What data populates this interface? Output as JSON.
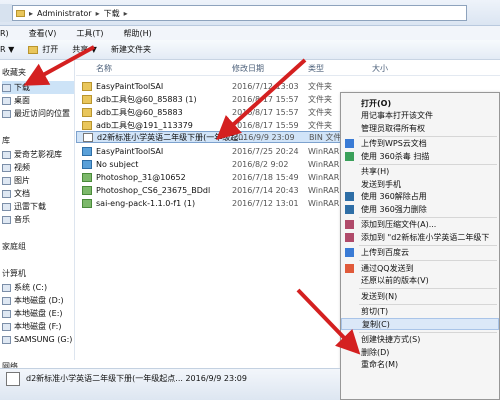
{
  "address": {
    "segments": [
      "Administrator",
      "下载"
    ]
  },
  "menu": {
    "items": [
      "R)",
      "查看(V)",
      "工具(T)",
      "帮助(H)"
    ]
  },
  "toolbar": {
    "items": [
      "R ▼",
      "打开",
      "共享 ▼",
      "新建文件夹"
    ]
  },
  "nav": {
    "items": [
      {
        "label": "收藏夹",
        "head": true
      },
      {
        "label": "下载",
        "sel": true
      },
      {
        "label": "桌面"
      },
      {
        "label": "最近访问的位置"
      },
      {
        "label": "库",
        "head": true
      },
      {
        "label": "爱奇艺影视库"
      },
      {
        "label": "视频"
      },
      {
        "label": "图片"
      },
      {
        "label": "文档"
      },
      {
        "label": "迅雷下载"
      },
      {
        "label": "音乐"
      },
      {
        "label": "家庭组",
        "head": true
      },
      {
        "label": "计算机",
        "head": true
      },
      {
        "label": "系统 (C:)"
      },
      {
        "label": "本地磁盘 (D:)"
      },
      {
        "label": "本地磁盘 (E:)"
      },
      {
        "label": "本地磁盘 (F:)"
      },
      {
        "label": "SAMSUNG (G:)"
      },
      {
        "label": "网络",
        "head": true
      }
    ]
  },
  "columns": {
    "name": "名称",
    "date": "修改日期",
    "type": "类型",
    "size": "大小"
  },
  "files": [
    {
      "name": "EasyPaintToolSAI",
      "date": "2016/7/12 13:03",
      "type": "文件夹",
      "icon": "folder"
    },
    {
      "name": "adb工具包@60_85883 (1)",
      "date": "2016/8/17 15:57",
      "type": "文件夹",
      "icon": "folder"
    },
    {
      "name": "adb工具包@60_85883",
      "date": "2016/8/17 15:57",
      "type": "文件夹",
      "icon": "folder"
    },
    {
      "name": "adb工具包@191_113379",
      "date": "2016/8/17 15:59",
      "type": "文件夹",
      "icon": "folder"
    },
    {
      "name": "d2新标准小学英语二年级下册(一年级起...",
      "date": "2016/9/9 23:09",
      "type": "BIN 文件",
      "icon": "bin",
      "sel": true
    },
    {
      "name": "EasyPaintToolSAI",
      "date": "2016/7/25 20:24",
      "type": "WinRAR Z",
      "icon": "img"
    },
    {
      "name": "No subject",
      "date": "2016/8/2 9:02",
      "type": "WinRAR 压",
      "icon": "img"
    },
    {
      "name": "Photoshop_31@10652",
      "date": "2016/7/18 15:49",
      "type": "WinRAR Z",
      "icon": "gr"
    },
    {
      "name": "Photoshop_CS6_23675_BDdl",
      "date": "2016/7/14 20:43",
      "type": "WinRAR Z",
      "icon": "gr"
    },
    {
      "name": "sai-eng-pack-1.1.0-f1 (1)",
      "date": "2016/7/12 13:01",
      "type": "WinRAR Z",
      "icon": "gr"
    }
  ],
  "context_menu": {
    "items": [
      {
        "label": "打开(O)",
        "bold": true
      },
      {
        "label": "用记事本打开该文件"
      },
      {
        "label": "管理员取得所有权"
      },
      {
        "sep": true
      },
      {
        "label": "上传到WPS云文档",
        "icon": "#3a7bd5"
      },
      {
        "label": "使用 360杀毒 扫描",
        "icon": "#3aa05a"
      },
      {
        "sep": true
      },
      {
        "label": "共享(H)"
      },
      {
        "label": "发送到手机"
      },
      {
        "label": "使用 360解除占用",
        "icon": "#2e6ea6"
      },
      {
        "label": "使用 360强力删除",
        "icon": "#2e6ea6"
      },
      {
        "sep": true
      },
      {
        "label": "添加到压缩文件(A)...",
        "icon": "#b04a6a"
      },
      {
        "label": "添加到 \"d2新标准小学英语二年级下",
        "icon": "#b04a6a"
      },
      {
        "sep": true
      },
      {
        "label": "上传到百度云",
        "icon": "#3a7bd5"
      },
      {
        "sep": true
      },
      {
        "label": "通过QQ发送到",
        "icon": "#e05a3a"
      },
      {
        "label": "还原以前的版本(V)"
      },
      {
        "sep": true
      },
      {
        "label": "发送到(N)"
      },
      {
        "sep": true
      },
      {
        "label": "剪切(T)"
      },
      {
        "label": "复制(C)",
        "hl": true
      },
      {
        "sep": true
      },
      {
        "label": "创建快捷方式(S)"
      },
      {
        "label": "删除(D)"
      },
      {
        "label": "重命名(M)"
      }
    ]
  },
  "status": {
    "text": "d2新标准小学英语二年级下册(一年级起点... 2016/9/9 23:09"
  },
  "colors": {
    "arrow": "#d42020",
    "selection": "#d1e4f8"
  }
}
